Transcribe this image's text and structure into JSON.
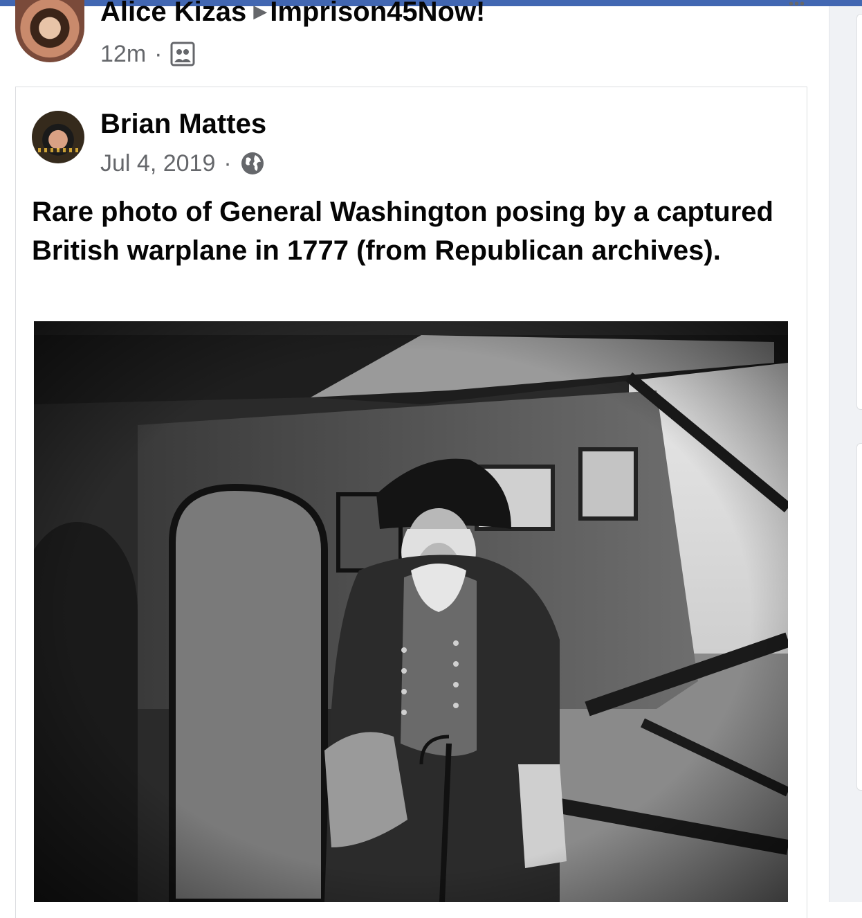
{
  "sharer": {
    "name": "Alice Kizas",
    "group": "Imprison45Now!",
    "time": "12m",
    "privacy_icon": "group-icon"
  },
  "more_icon": "more-dots-icon",
  "post": {
    "author": "Brian Mattes",
    "date": "Jul 4, 2019",
    "privacy_icon": "globe-icon",
    "text": "Rare photo of General Washington posing by a captured British warplane in 1777 (from Republican archives).",
    "photo_icon": "photo-image"
  },
  "colors": {
    "brand": "#4267b2",
    "secondary_text": "#65676b",
    "primary_text": "#050505"
  }
}
